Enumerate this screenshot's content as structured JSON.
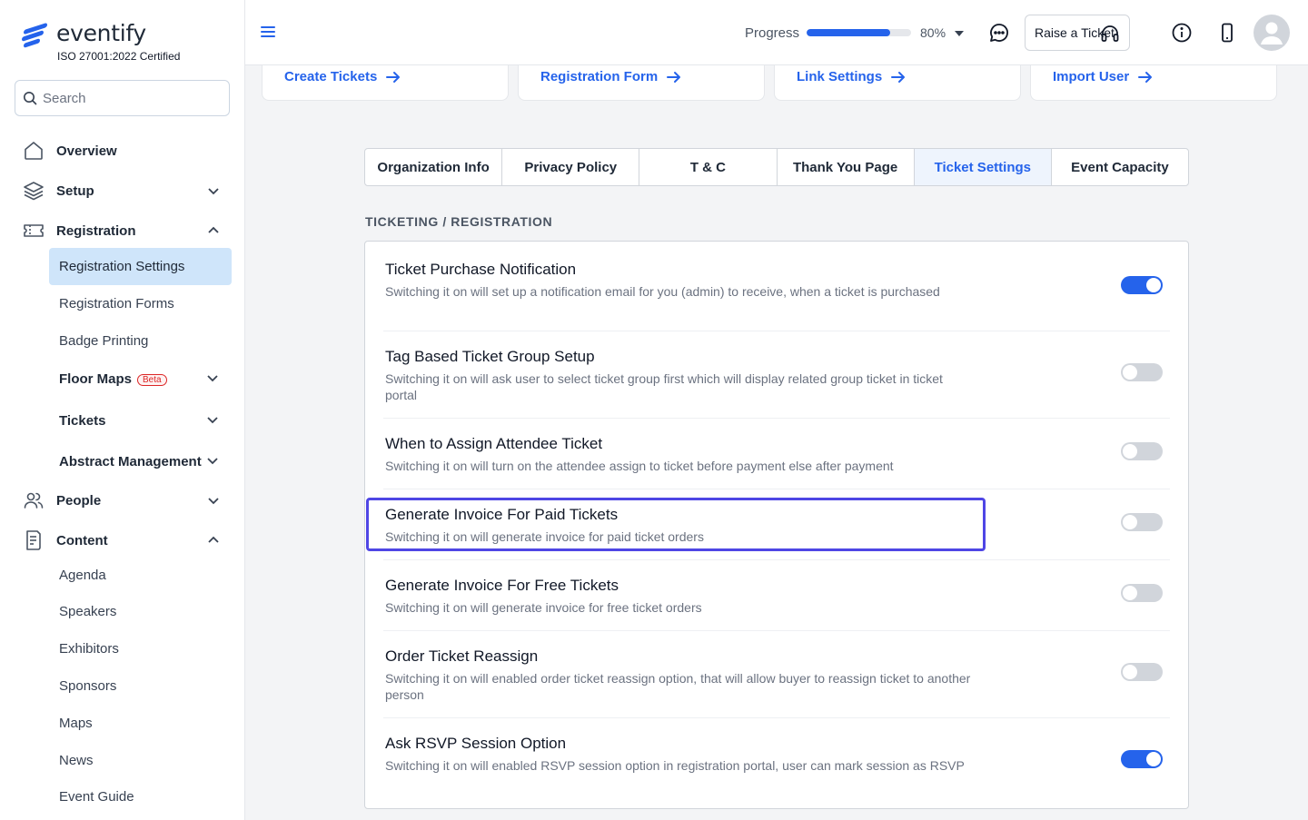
{
  "brand": {
    "name": "eventify",
    "certification": "ISO 27001:2022 Certified",
    "accent": "#2563eb"
  },
  "search": {
    "placeholder": "Search"
  },
  "sidebar": {
    "items": [
      {
        "label": "Overview",
        "icon": "home-icon"
      },
      {
        "label": "Setup",
        "icon": "layers-icon"
      },
      {
        "label": "Registration",
        "icon": "ticket-icon"
      },
      {
        "label": "People",
        "icon": "users-icon"
      },
      {
        "label": "Content",
        "icon": "document-icon"
      }
    ],
    "registration_sub": [
      "Registration Settings",
      "Registration Forms",
      "Badge Printing",
      "Floor Maps",
      "Tickets",
      "Abstract Management"
    ],
    "beta_label": "Beta",
    "content_sub": [
      "Agenda",
      "Speakers",
      "Exhibitors",
      "Sponsors",
      "Maps",
      "News",
      "Event Guide"
    ]
  },
  "topbar": {
    "progress_label": "Progress",
    "progress_value": 0.8,
    "progress_text": "80%",
    "raise_ticket_label": "Raise a Ticket"
  },
  "quick_links": [
    "Create Tickets",
    "Registration Form",
    "Link Settings",
    "Import User"
  ],
  "tabs": [
    {
      "label": "Organization Info",
      "active": false
    },
    {
      "label": "Privacy Policy",
      "active": false
    },
    {
      "label": "T & C",
      "active": false
    },
    {
      "label": "Thank You Page",
      "active": false
    },
    {
      "label": "Ticket Settings",
      "active": true
    },
    {
      "label": "Event Capacity",
      "active": false
    }
  ],
  "section_title": "TICKETING / REGISTRATION",
  "settings": [
    {
      "title": "Ticket Purchase Notification",
      "desc": "Switching it on will set up a notification email for you (admin) to receive, when a ticket is purchased",
      "on": true
    },
    {
      "title": "Tag Based Ticket Group Setup",
      "desc": "Switching it on will ask user to select ticket group first which will display related group ticket in ticket portal",
      "on": false
    },
    {
      "title": "When to Assign Attendee Ticket",
      "desc": "Switching it on will turn on the attendee assign to ticket before payment else after payment",
      "on": false
    },
    {
      "title": "Generate Invoice For Paid Tickets",
      "desc": "Switching it on will generate invoice for paid ticket orders",
      "on": false
    },
    {
      "title": "Generate Invoice For Free Tickets",
      "desc": "Switching it on will generate invoice for free ticket orders",
      "on": false
    },
    {
      "title": "Order Ticket Reassign",
      "desc": "Switching it on will enabled order ticket reassign option, that will allow buyer to reassign ticket to another person",
      "on": false
    },
    {
      "title": "Ask RSVP Session Option",
      "desc": "Switching it on will enabled RSVP session option in registration portal, user can mark session as RSVP",
      "on": true
    }
  ]
}
